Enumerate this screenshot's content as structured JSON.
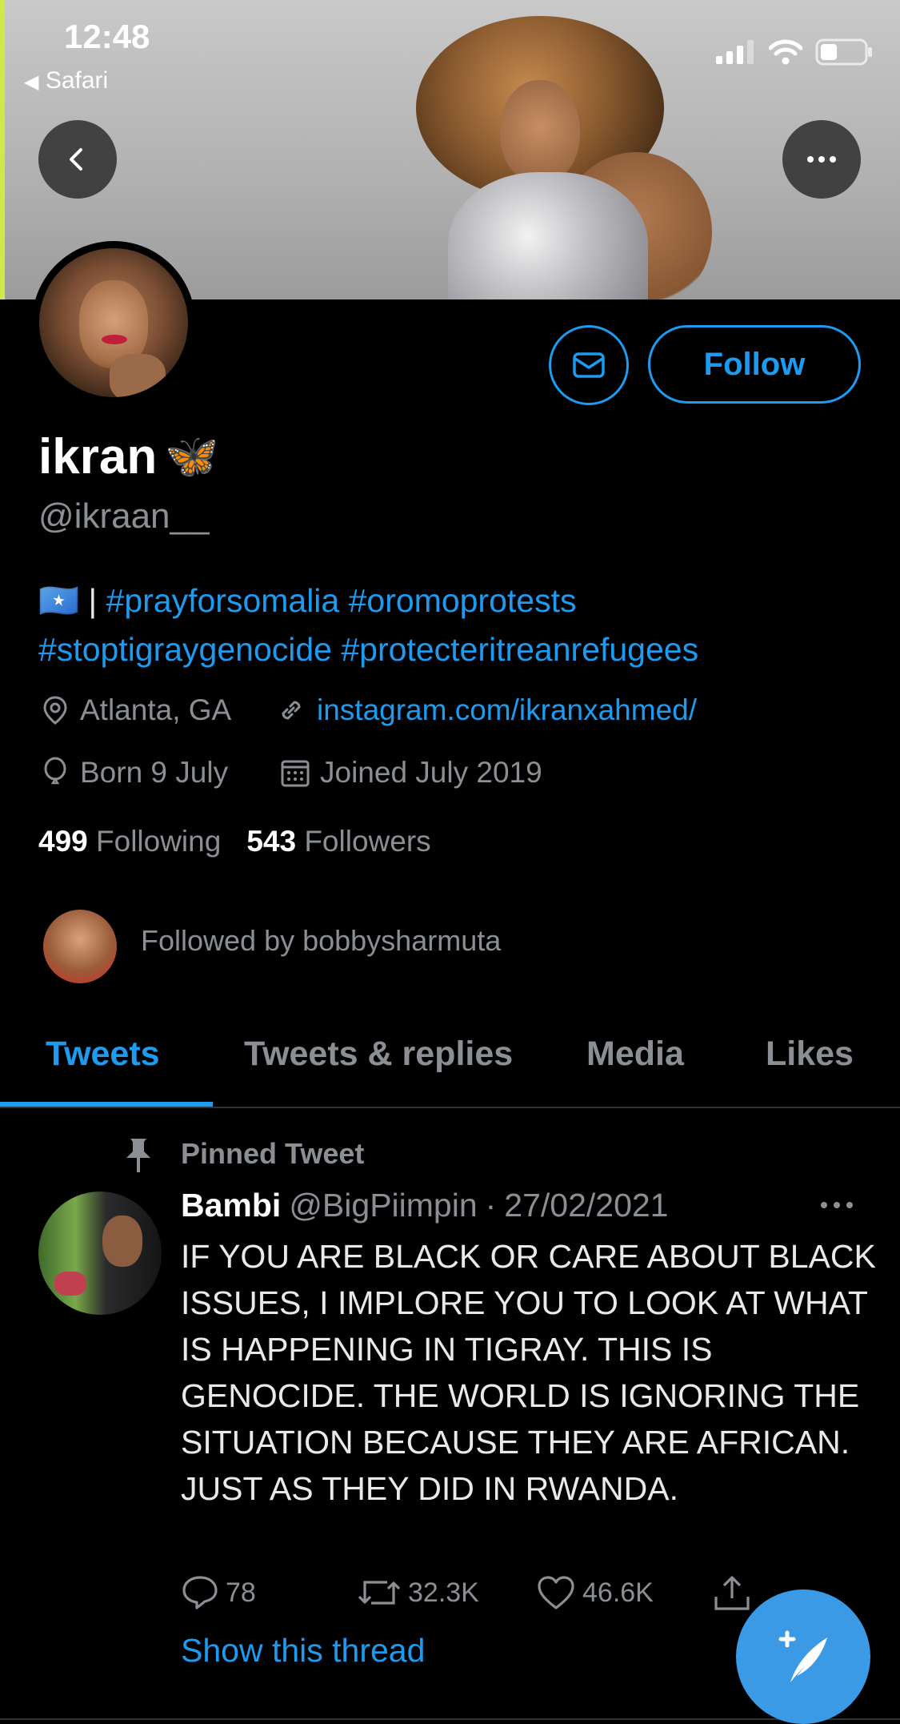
{
  "status_bar": {
    "time": "12:48",
    "back_app": "Safari"
  },
  "profile": {
    "display_name": "ikran",
    "name_emoji": "🦋",
    "handle": "@ikraan__",
    "follow_label": "Follow",
    "bio_flag": "🇸🇴",
    "bio_separator": "|",
    "bio_tags_line1": "#prayforsomalia #oromoprotests",
    "bio_tags_line2": "#stoptigraygenocide #protecteritreanrefugees",
    "location": "Atlanta, GA",
    "website": "instagram.com/ikranxahmed/",
    "birthday": "Born 9 July",
    "joined": "Joined July 2019",
    "following_count": "499",
    "following_label": "Following",
    "followers_count": "543",
    "followers_label": "Followers",
    "followed_by": "Followed by bobbysharmuta"
  },
  "tabs": [
    {
      "label": "Tweets",
      "active": true
    },
    {
      "label": "Tweets & replies",
      "active": false
    },
    {
      "label": "Media",
      "active": false
    },
    {
      "label": "Likes",
      "active": false
    }
  ],
  "pinned_tweet": {
    "pinned_label": "Pinned Tweet",
    "author_name": "Bambi",
    "author_handle": "@BigPiimpin",
    "separator": "·",
    "date": "27/02/2021",
    "text": "IF YOU ARE BLACK OR CARE ABOUT BLACK ISSUES, I IMPLORE YOU TO LOOK AT WHAT IS HAPPENING IN TIGRAY. THIS IS GENOCIDE. THE WORLD IS IGNORING THE SITUATION BECAUSE THEY ARE AFRICAN. JUST AS THEY DID IN RWANDA.",
    "reply_count": "78",
    "retweet_count": "32.3K",
    "like_count": "46.6K",
    "show_thread": "Show this thread"
  },
  "icons": {
    "back": "chevron-left-icon",
    "more": "more-horizontal-icon",
    "mail": "mail-icon",
    "location": "location-pin-icon",
    "link": "link-icon",
    "birthday": "balloon-icon",
    "calendar": "calendar-icon",
    "pin": "pin-icon",
    "reply": "reply-icon",
    "retweet": "retweet-icon",
    "like": "heart-icon",
    "share": "share-icon",
    "compose": "compose-icon"
  },
  "colors": {
    "accent": "#1d9bf0",
    "background": "#000000",
    "muted": "#8b8f94",
    "fab": "#3a9ae6"
  }
}
